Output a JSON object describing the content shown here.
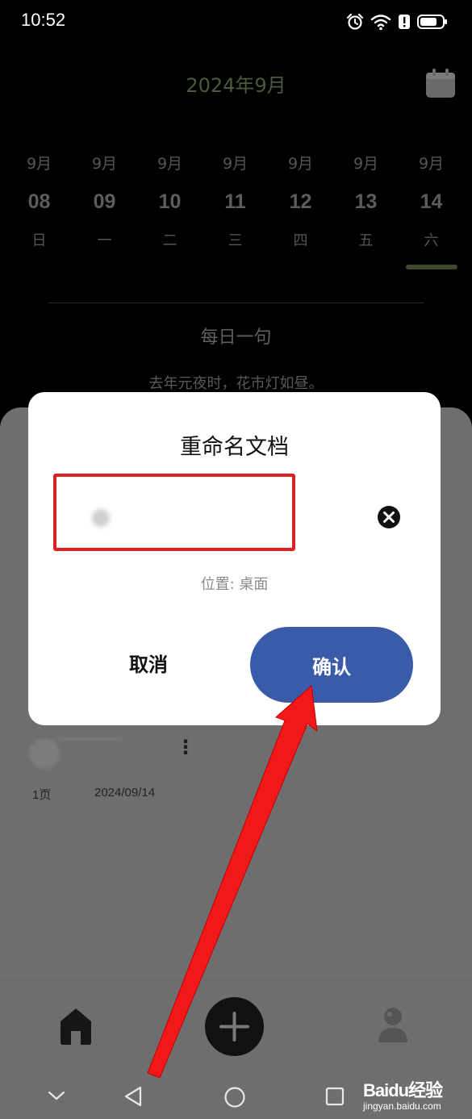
{
  "status_bar": {
    "time": "10:52",
    "icons": [
      "alarm-icon",
      "wifi-icon",
      "alert-icon",
      "battery-icon"
    ]
  },
  "header": {
    "month_title": "2024年9月",
    "calendar_icon": "calendar-icon"
  },
  "week": {
    "days": [
      {
        "month": "9月",
        "date": "08",
        "weekday": "日",
        "selected": false
      },
      {
        "month": "9月",
        "date": "09",
        "weekday": "一",
        "selected": false
      },
      {
        "month": "9月",
        "date": "10",
        "weekday": "二",
        "selected": false
      },
      {
        "month": "9月",
        "date": "11",
        "weekday": "三",
        "selected": false
      },
      {
        "month": "9月",
        "date": "12",
        "weekday": "四",
        "selected": false
      },
      {
        "month": "9月",
        "date": "13",
        "weekday": "五",
        "selected": false
      },
      {
        "month": "9月",
        "date": "14",
        "weekday": "六",
        "selected": true
      }
    ]
  },
  "daily_quote": {
    "title": "每日一句",
    "text": "去年元夜时，花市灯如昼。"
  },
  "document": {
    "pages": "1页",
    "date": "2024/09/14"
  },
  "dialog": {
    "title": "重命名文档",
    "input_value": "",
    "location_label": "位置: 桌面",
    "cancel_label": "取消",
    "confirm_label": "确认"
  },
  "bottom_nav": {
    "items": [
      "home-icon",
      "add-icon",
      "profile-icon"
    ]
  },
  "watermark": {
    "brand": "Baidu经验",
    "url": "jingyan.baidu.com"
  },
  "colors": {
    "confirm_button": "#3a5ba9",
    "highlight_box": "#e02020",
    "arrow": "#f01818",
    "month_title": "#4a5a3c"
  }
}
